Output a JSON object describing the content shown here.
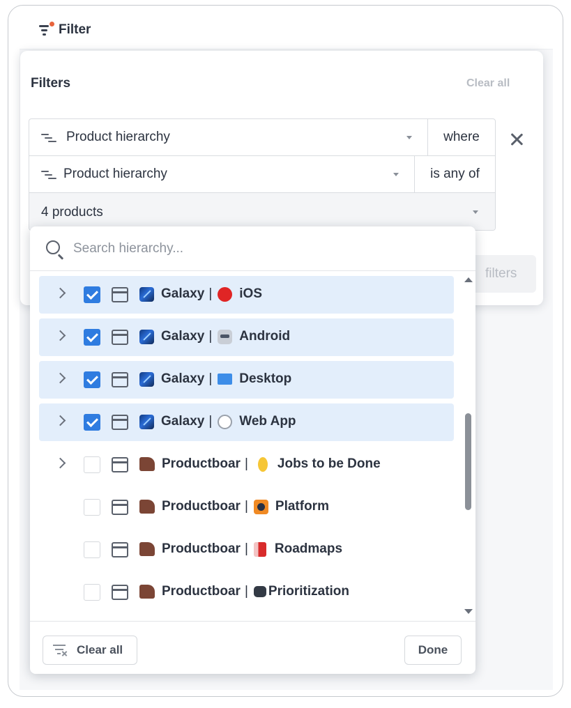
{
  "header": {
    "filter_label": "Filter"
  },
  "filters_panel": {
    "title": "Filters",
    "clear_all": "Clear all",
    "row1": {
      "field": "Product hierarchy",
      "operator": "where"
    },
    "row2": {
      "field": "Product hierarchy",
      "operator": "is any of"
    },
    "row3": {
      "value": "4 products"
    },
    "add_filters_label": "filters"
  },
  "dropdown": {
    "search_placeholder": "Search hierarchy...",
    "items": [
      {
        "org": "Galaxy",
        "org_icon": "galaxy-icon",
        "name": "iOS",
        "icon": "apple-icon",
        "checked": true,
        "expandable": true
      },
      {
        "org": "Galaxy",
        "org_icon": "galaxy-icon",
        "name": "Android",
        "icon": "robot-icon",
        "checked": true,
        "expandable": true
      },
      {
        "org": "Galaxy",
        "org_icon": "galaxy-icon",
        "name": "Desktop",
        "icon": "desktop-icon",
        "checked": true,
        "expandable": true
      },
      {
        "org": "Galaxy",
        "org_icon": "galaxy-icon",
        "name": "Web App",
        "icon": "web-icon",
        "checked": true,
        "expandable": true
      },
      {
        "org": "Productboar",
        "org_icon": "productboard-icon",
        "name": "Jobs to be Done",
        "icon": "lightbulb-icon",
        "checked": false,
        "expandable": true
      },
      {
        "org": "Productboar",
        "org_icon": "productboard-icon",
        "name": "Platform",
        "icon": "platform-icon",
        "checked": false,
        "expandable": false
      },
      {
        "org": "Productboar",
        "org_icon": "productboard-icon",
        "name": "Roadmaps",
        "icon": "megaphone-icon",
        "checked": false,
        "expandable": false
      },
      {
        "org": "Productboar",
        "org_icon": "productboard-icon",
        "name": "Prioritization",
        "icon": "binoculars-icon",
        "checked": false,
        "expandable": false
      }
    ],
    "separator": "|",
    "clear_all": "Clear all",
    "done": "Done"
  },
  "colors": {
    "accent": "#2f7ce0",
    "selected_row": "#e3eefb",
    "notification_dot": "#e8643c"
  }
}
